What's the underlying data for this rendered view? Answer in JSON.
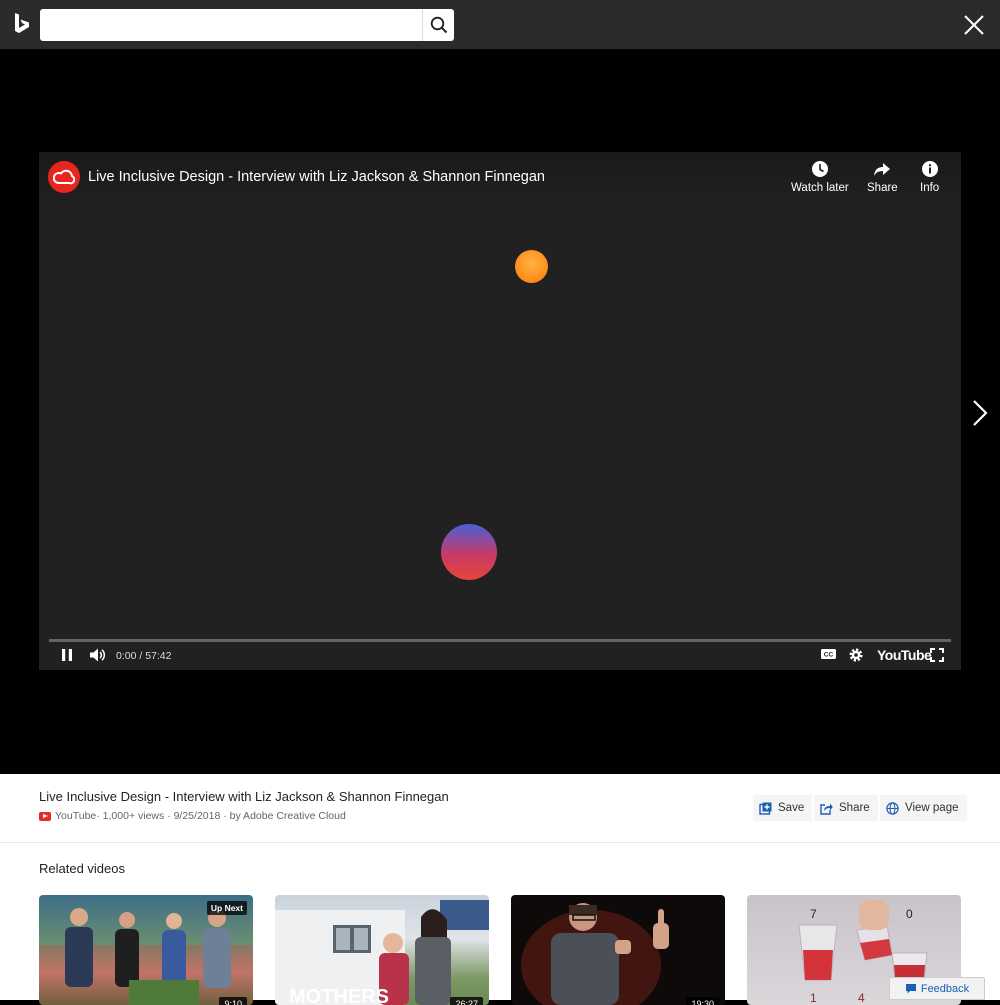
{
  "search": {
    "value": "",
    "placeholder": ""
  },
  "player": {
    "title": "Live Inclusive Design - Interview with Liz Jackson & Shannon Finnegan",
    "actions": {
      "watch_later": "Watch later",
      "share": "Share",
      "info": "Info"
    },
    "time_current": "0:00",
    "time_total": "57:42",
    "time_display": "0:00 / 57:42",
    "progress": 0,
    "brand": "YouTube"
  },
  "details": {
    "title": "Live Inclusive Design - Interview with Liz Jackson & Shannon Finnegan",
    "source": "YouTube",
    "meta": " · 1,000+ views · 9/25/2018 · by Adobe Creative Cloud",
    "buttons": {
      "save": "Save",
      "share": "Share",
      "view_page": "View page"
    }
  },
  "related": {
    "heading": "Related videos",
    "items": [
      {
        "badge": "Up Next",
        "duration": "9:10",
        "image_text": ""
      },
      {
        "badge": "",
        "duration": "26:27",
        "image_text": "MOTHERS"
      },
      {
        "badge": "",
        "duration": "19:30",
        "image_text": ""
      },
      {
        "badge": "",
        "duration": "",
        "image_text": "7 0 1 4"
      }
    ]
  },
  "feedback": {
    "label": "Feedback"
  },
  "colors": {
    "topbar": "#2b2b2b",
    "player_bg": "#212121",
    "brand_red": "#e8261e",
    "link_blue": "#1a5fb4"
  }
}
